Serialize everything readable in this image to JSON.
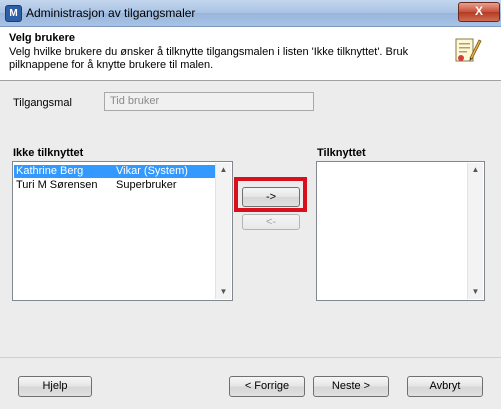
{
  "window": {
    "title": "Administrasjon av tilgangsmaler",
    "close_label": "X",
    "app_icon_letter": "M"
  },
  "header": {
    "title": "Velg brukere",
    "description": "Velg hvilke brukere du ønsker å tilknytte tilgangsmalen i listen 'Ikke tilknyttet'. Bruk pilknappene for å knytte brukere til malen."
  },
  "form": {
    "tilgangsmal_label": "Tilgangsmal",
    "tilgangsmal_value": "Tid bruker"
  },
  "lists": {
    "unassigned_title": "Ikke tilknyttet",
    "assigned_title": "Tilknyttet",
    "unassigned_items": [
      {
        "name": "Kathrine Berg",
        "role": "Vikar (System)",
        "selected": true
      },
      {
        "name": "Turi M Sørensen",
        "role": "Superbruker",
        "selected": false
      }
    ],
    "assigned_items": []
  },
  "move_buttons": {
    "add": "->",
    "remove": "<-"
  },
  "footer": {
    "help": "Hjelp",
    "back": "< Forrige",
    "next": "Neste >",
    "cancel": "Avbryt"
  },
  "colors": {
    "selection": "#3399ff",
    "highlight_border": "#d90f1c"
  }
}
